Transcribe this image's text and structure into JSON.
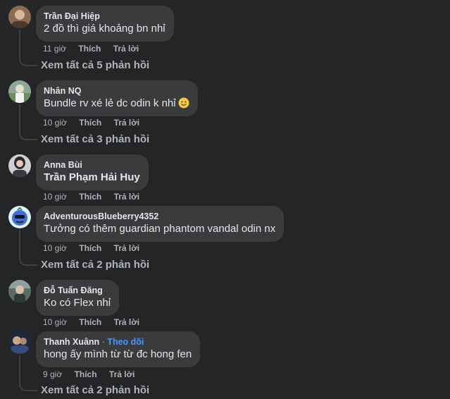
{
  "comments": [
    {
      "author": "Trần Đại Hiệp",
      "text": "2 đồ thì giá khoảng bn nhỉ",
      "time": "11 giờ",
      "like": "Thích",
      "reply": "Trả lời",
      "view_replies": "Xem tất cả 5 phản hồi"
    },
    {
      "author": "Nhân NQ",
      "text": "Bundle rv xé lẻ dc odin k nhỉ",
      "emoji": "smiling-face-emoji",
      "time": "10 giờ",
      "like": "Thích",
      "reply": "Trả lời",
      "view_replies": "Xem tất cả 3 phản hồi"
    },
    {
      "author": "Anna Bùi",
      "text": "Trần Phạm Hải Huy",
      "time": "10 giờ",
      "like": "Thích",
      "reply": "Trả lời"
    },
    {
      "author": "AdventurousBlueberry4352",
      "text": "Tưởng có thêm guardian phantom vandal odin nx",
      "time": "10 giờ",
      "like": "Thích",
      "reply": "Trả lời",
      "view_replies": "Xem tất cả 2 phản hồi"
    },
    {
      "author": "Đỗ Tuấn Đăng",
      "text": "Ko có Flex nhỉ",
      "time": "10 giờ",
      "like": "Thích",
      "reply": "Trả lời"
    },
    {
      "author": "Thanh Xuânn",
      "separator": "·",
      "follow": "Theo dõi",
      "text": "hong ấy mình từ từ đc hong fen",
      "time": "9 giờ",
      "like": "Thích",
      "reply": "Trả lời",
      "view_replies": "Xem tất cả 2 phản hồi"
    }
  ],
  "colors": {
    "background": "#242526",
    "bubble": "#3a3b3c",
    "text": "#e4e6eb",
    "secondary": "#b0b3b8",
    "link": "#4599ff"
  }
}
